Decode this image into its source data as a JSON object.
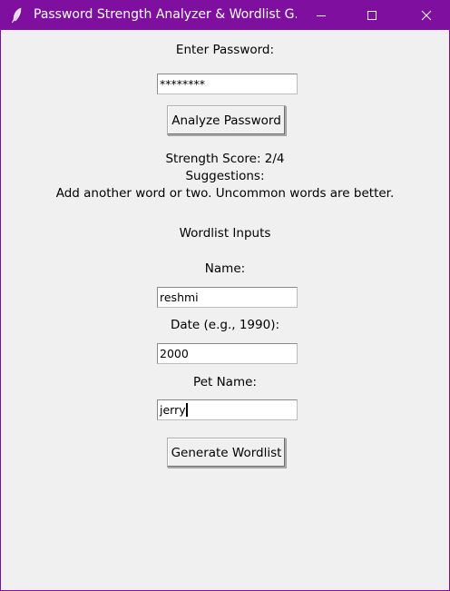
{
  "window": {
    "title": "Password Strength Analyzer & Wordlist G...",
    "icon": "feather-icon",
    "controls": [
      "minimize-icon",
      "maximize-icon",
      "close-icon"
    ],
    "titlebar_color": "#7f0f9e"
  },
  "password": {
    "label": "Enter Password:",
    "value": "********",
    "analyze_label": "Analyze Password"
  },
  "result": {
    "score": "Strength Score: 2/4",
    "suggestions_heading": "Suggestions:",
    "suggestion": "Add another word or two. Uncommon words are better."
  },
  "wordlist": {
    "heading": "Wordlist Inputs",
    "name_label": "Name:",
    "name_value": "reshmi",
    "date_label": "Date (e.g., 1990):",
    "date_value": "2000",
    "pet_label": "Pet Name:",
    "pet_value": "jerry",
    "generate_label": "Generate Wordlist"
  }
}
